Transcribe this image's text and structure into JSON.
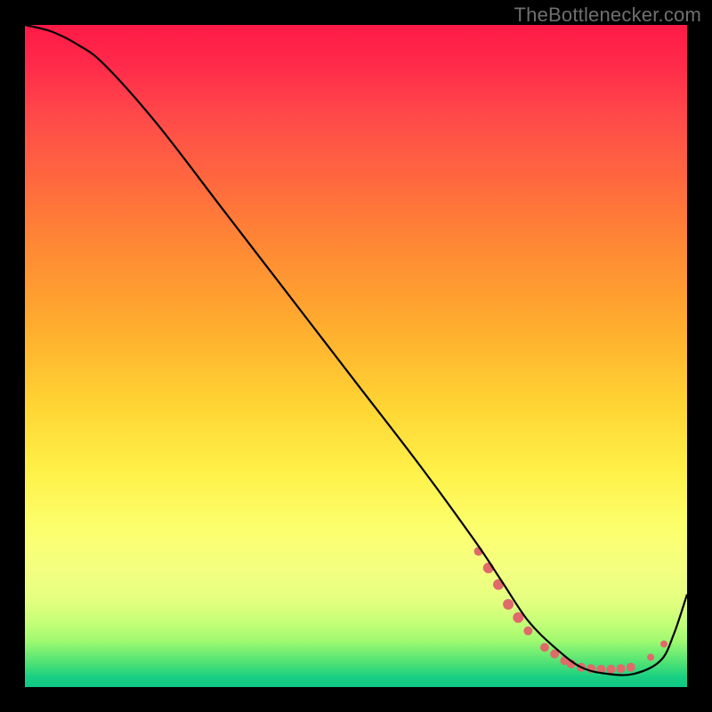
{
  "attribution": "TheBottlenecker.com",
  "chart_data": {
    "type": "line",
    "title": "",
    "xlabel": "",
    "ylabel": "",
    "xlim": [
      0,
      100
    ],
    "ylim": [
      0,
      100
    ],
    "series": [
      {
        "name": "bottleneck-curve",
        "x": [
          0,
          4,
          8,
          12,
          20,
          30,
          40,
          50,
          60,
          68,
          72,
          76,
          80,
          84,
          88,
          92,
          96,
          98,
          100
        ],
        "y": [
          100,
          99,
          97,
          94,
          85,
          72,
          59,
          46,
          33,
          22,
          16,
          10,
          6,
          3,
          2,
          2,
          4,
          8,
          14
        ]
      }
    ],
    "markers": {
      "name": "highlighted-points",
      "color": "#e06a6a",
      "points": [
        {
          "x": 68.5,
          "y": 20.5,
          "r": 5
        },
        {
          "x": 70.0,
          "y": 18.0,
          "r": 6
        },
        {
          "x": 71.5,
          "y": 15.5,
          "r": 6
        },
        {
          "x": 73.0,
          "y": 12.5,
          "r": 6
        },
        {
          "x": 74.5,
          "y": 10.5,
          "r": 6
        },
        {
          "x": 76.0,
          "y": 8.5,
          "r": 5
        },
        {
          "x": 78.5,
          "y": 6.0,
          "r": 5
        },
        {
          "x": 80.0,
          "y": 5.0,
          "r": 5
        },
        {
          "x": 81.5,
          "y": 4.0,
          "r": 5
        },
        {
          "x": 82.5,
          "y": 3.5,
          "r": 5
        },
        {
          "x": 84.0,
          "y": 3.0,
          "r": 5
        },
        {
          "x": 85.5,
          "y": 2.8,
          "r": 5
        },
        {
          "x": 87.0,
          "y": 2.7,
          "r": 5
        },
        {
          "x": 88.5,
          "y": 2.7,
          "r": 5
        },
        {
          "x": 90.0,
          "y": 2.8,
          "r": 5
        },
        {
          "x": 91.5,
          "y": 3.0,
          "r": 5
        },
        {
          "x": 94.5,
          "y": 4.5,
          "r": 4
        },
        {
          "x": 96.5,
          "y": 6.5,
          "r": 4
        }
      ]
    },
    "gradient_stops": [
      {
        "pos": 0.0,
        "color": "#ff1a46"
      },
      {
        "pos": 0.5,
        "color": "#ffcf34"
      },
      {
        "pos": 0.8,
        "color": "#f6ff78"
      },
      {
        "pos": 1.0,
        "color": "#10c886"
      }
    ]
  }
}
